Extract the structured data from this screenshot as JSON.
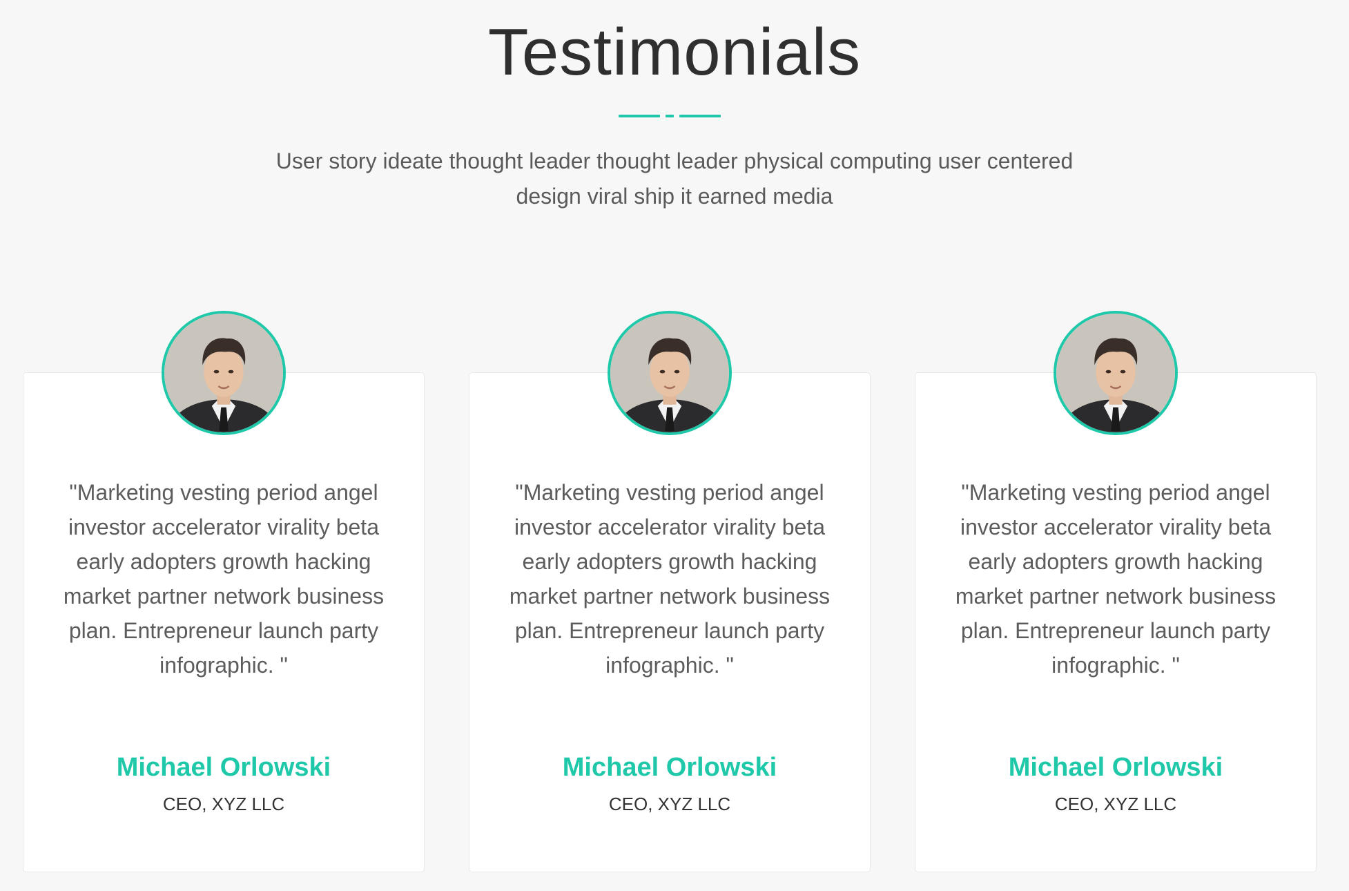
{
  "header": {
    "title": "Testimonials",
    "subtitle": "User story ideate thought leader thought leader physical computing user centered design viral ship it earned media"
  },
  "colors": {
    "accent": "#1fc8a9",
    "background": "#f7f7f7",
    "card": "#ffffff"
  },
  "testimonials": [
    {
      "quote": "\"Marketing vesting period angel investor accelerator virality beta early adopters growth hacking market partner network business plan. Entrepreneur launch party infographic. \"",
      "name": "Michael Orlowski",
      "role": "CEO, XYZ LLC",
      "avatar_icon": "person-portrait"
    },
    {
      "quote": "\"Marketing vesting period angel investor accelerator virality beta early adopters growth hacking market partner network business plan. Entrepreneur launch party infographic. \"",
      "name": "Michael Orlowski",
      "role": "CEO, XYZ LLC",
      "avatar_icon": "person-portrait"
    },
    {
      "quote": "\"Marketing vesting period angel investor accelerator virality beta early adopters growth hacking market partner network business plan. Entrepreneur launch party infographic. \"",
      "name": "Michael Orlowski",
      "role": "CEO, XYZ LLC",
      "avatar_icon": "person-portrait"
    }
  ]
}
